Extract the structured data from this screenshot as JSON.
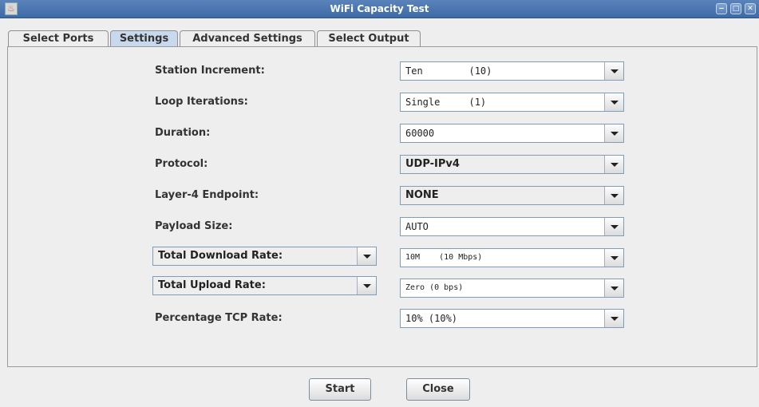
{
  "window": {
    "title": "WiFi Capacity Test",
    "minimize_glyph": "‒",
    "maximize_glyph": "□",
    "close_glyph": "✕"
  },
  "tabs": [
    {
      "label": "Select Ports",
      "active": false
    },
    {
      "label": "Settings",
      "active": true
    },
    {
      "label": "Advanced Settings",
      "active": false
    },
    {
      "label": "Select Output",
      "active": false
    }
  ],
  "settings": {
    "station_increment": {
      "label": "Station Increment:",
      "value": "Ten        (10)"
    },
    "loop_iterations": {
      "label": "Loop Iterations:",
      "value": "Single     (1)"
    },
    "duration": {
      "label": "Duration:",
      "value": "60000"
    },
    "protocol": {
      "label": "Protocol:",
      "value": "UDP-IPv4"
    },
    "layer4_endpoint": {
      "label": "Layer-4 Endpoint:",
      "value": "NONE"
    },
    "payload_size": {
      "label": "Payload Size:",
      "value": "AUTO"
    },
    "total_download_rate": {
      "label": "Total Download Rate:",
      "value": "10M    (10 Mbps)"
    },
    "total_upload_rate": {
      "label": "Total Upload Rate:",
      "value": "Zero (0 bps)"
    },
    "percentage_tcp_rate": {
      "label": "Percentage TCP Rate:",
      "value": "10% (10%)"
    }
  },
  "buttons": {
    "start": "Start",
    "close": "Close"
  },
  "icons": {
    "app": "java-app-icon",
    "dropdown": "chevron-down-icon"
  }
}
